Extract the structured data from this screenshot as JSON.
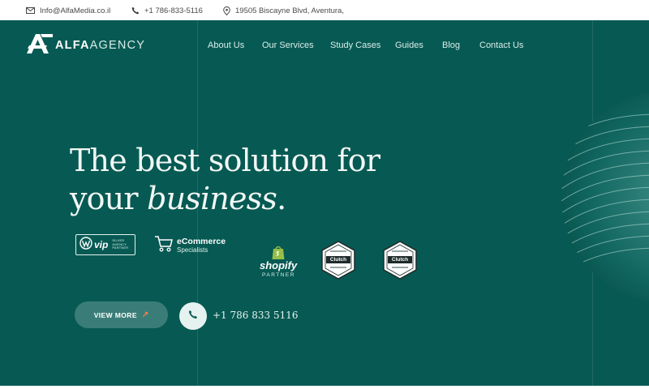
{
  "topbar": {
    "email": "Info@AlfaMedia.co.il",
    "phone": "+1 786-833-5116",
    "address": "19505 Biscayne Blvd, Aventura,"
  },
  "logo": {
    "bold": "ALFA",
    "light": "AGENCY"
  },
  "nav": {
    "items": [
      {
        "label": "About Us"
      },
      {
        "label": "Our Services"
      },
      {
        "label": "Study Cases"
      },
      {
        "label": "Guides"
      },
      {
        "label": "Blog"
      },
      {
        "label": "Contact Us"
      }
    ]
  },
  "hero": {
    "headline_line1": "The best solution for",
    "headline_line2_plain": "your",
    "headline_line2_italic": "business",
    "headline_line2_end": "."
  },
  "badges": {
    "wpvip": {
      "text": "vip",
      "small1": "SILVER",
      "small2": "AGENCY",
      "small3": "PARTNER"
    },
    "ecommerce": {
      "title": "eCommerce",
      "subtitle": "Specialists"
    },
    "shopify": {
      "word": "shopify",
      "partner": "PARTNER"
    },
    "clutch1": {
      "text": "Clutch"
    },
    "clutch2": {
      "text": "Clutch"
    }
  },
  "actions": {
    "view_more_label": "VIEW MORE",
    "arrow": "↗",
    "phone_display": "+1 786 833 5116"
  },
  "colors": {
    "hero_bg": "#075a53",
    "button_bg": "#3a7d78",
    "accent": "#ff7a4a",
    "text_light": "#f2f7f5"
  }
}
